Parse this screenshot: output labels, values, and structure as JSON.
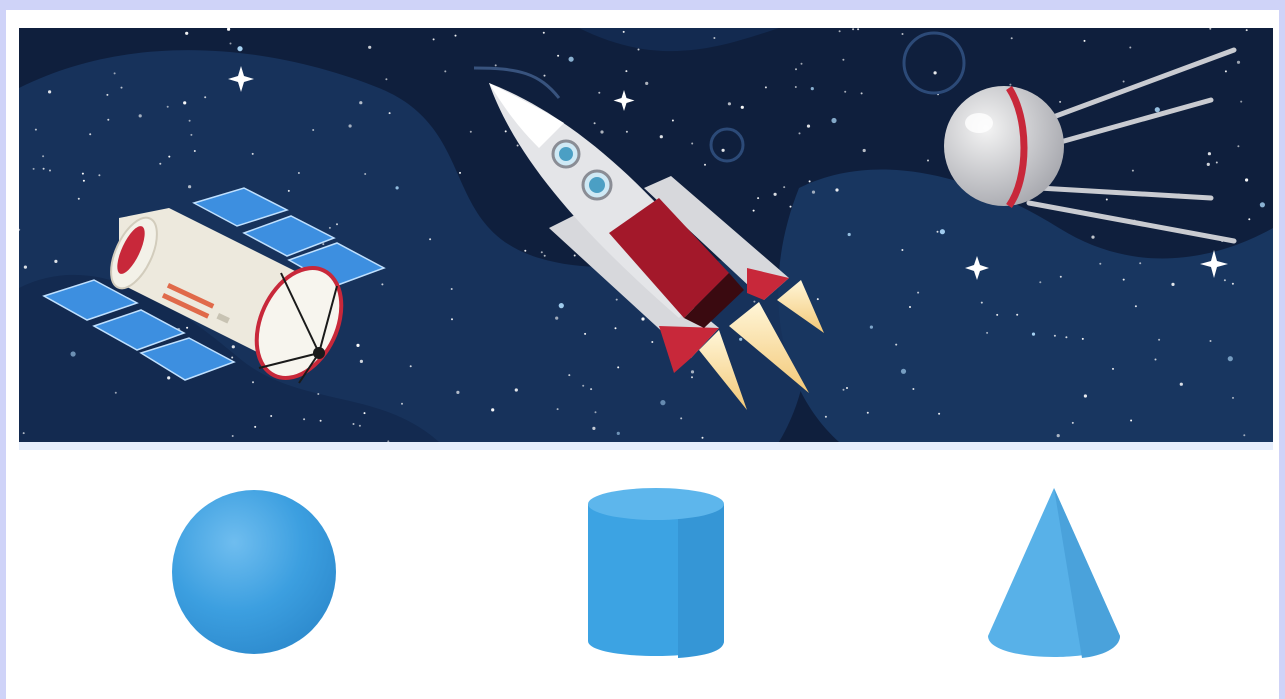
{
  "scene": {
    "objects": [
      "space-station",
      "rocket",
      "sputnik-satellite"
    ],
    "shapes": [
      "sphere",
      "cylinder",
      "cone"
    ]
  },
  "colors": {
    "outer_background": "#cfd3f8",
    "space_dark": "#0f1f3d",
    "space_mid": "#18345e",
    "shape_blue": "#3aa0e0",
    "rocket_red": "#c8283a"
  }
}
